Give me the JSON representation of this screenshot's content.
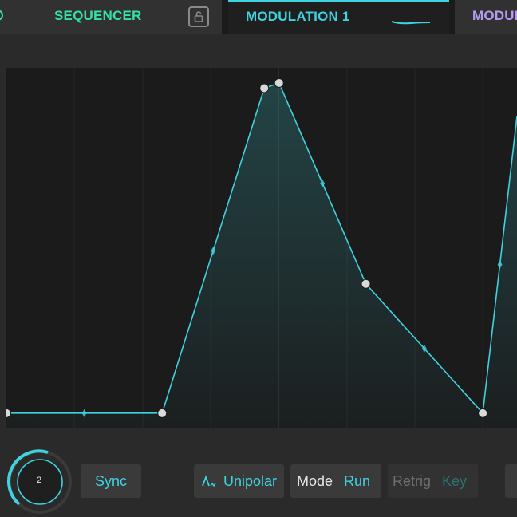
{
  "tabs": [
    {
      "label": "SEQUENCER",
      "color": "#35e0a6"
    },
    {
      "label": "MODULATION 1",
      "color": "#3fd3df",
      "active": true
    },
    {
      "label": "MODUL",
      "color": "#b59cf2"
    }
  ],
  "icons": {
    "power": "power-icon",
    "lock": "lock-icon",
    "wave": "wave-preview-icon",
    "unipolar": "unipolar-wave-icon"
  },
  "envelope": {
    "points": [
      [
        0,
        0.03
      ],
      [
        0.305,
        0.03
      ],
      [
        0.505,
        0.96
      ],
      [
        0.534,
        0.975
      ],
      [
        0.704,
        0.4
      ],
      [
        0.933,
        0.03
      ],
      [
        1,
        0.88
      ]
    ],
    "accent_color": "#3fd3df"
  },
  "controls": {
    "rate_value": "2",
    "sync_label": "Sync",
    "unipolar_label": "Unipolar",
    "mode_label": "Mode",
    "mode_value": "Run",
    "retrig_label": "Retrig",
    "key_label": "Key"
  }
}
